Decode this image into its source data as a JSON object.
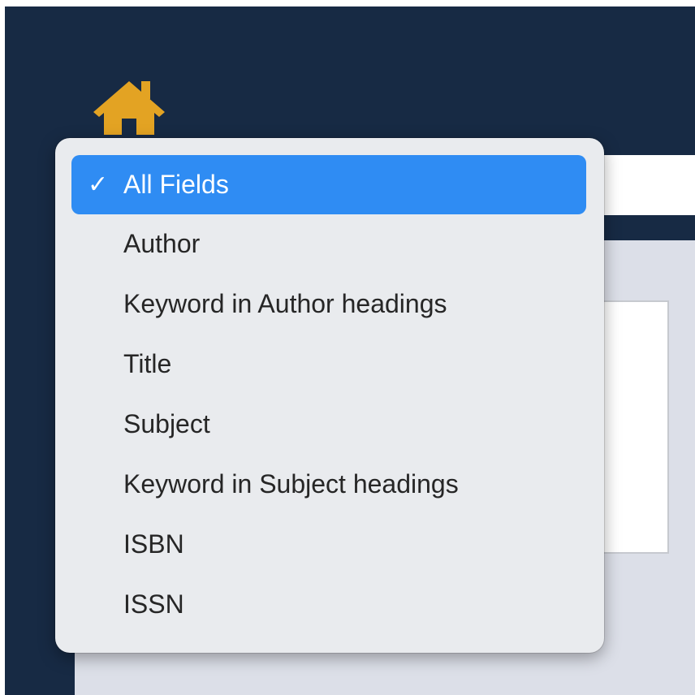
{
  "colors": {
    "header_navy": "#172a44",
    "home_icon": "#e3a323",
    "menu_background": "#e9ebee",
    "selection_blue": "#2f8cf3",
    "content_panel": "#dcdfe8"
  },
  "home": {
    "icon": "house-icon"
  },
  "search": {
    "value": ""
  },
  "dropdown": {
    "selected": "All Fields",
    "check_mark": "✓",
    "items": [
      {
        "label": "All Fields",
        "selected": true
      },
      {
        "label": "Author",
        "selected": false
      },
      {
        "label": "Keyword in Author headings",
        "selected": false
      },
      {
        "label": "Title",
        "selected": false
      },
      {
        "label": "Subject",
        "selected": false
      },
      {
        "label": "Keyword in Subject headings",
        "selected": false
      },
      {
        "label": "ISBN",
        "selected": false
      },
      {
        "label": "ISSN",
        "selected": false
      }
    ]
  }
}
